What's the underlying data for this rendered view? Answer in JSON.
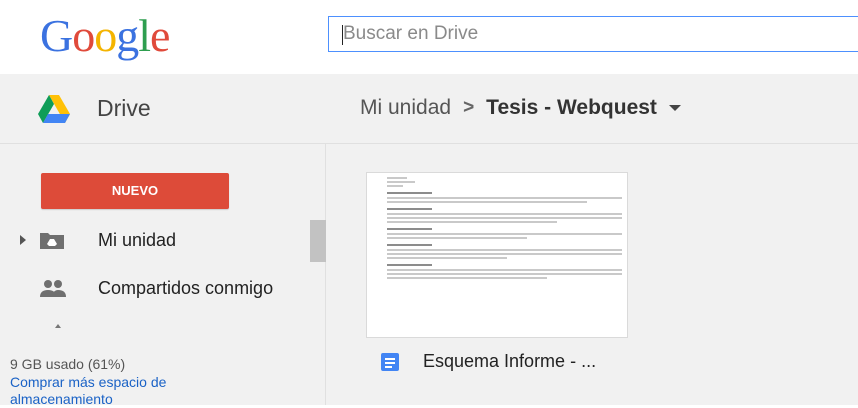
{
  "header": {
    "logo_letters": [
      "G",
      "o",
      "o",
      "g",
      "l",
      "e"
    ],
    "logo_colors": [
      "#3b72e0",
      "#e04a3b",
      "#f4b400",
      "#3b72e0",
      "#2e9e4f",
      "#e04a3b"
    ],
    "search_placeholder": "Buscar en Drive"
  },
  "appbar": {
    "app_name": "Drive",
    "breadcrumb_root": "Mi unidad",
    "breadcrumb_separator": ">",
    "breadcrumb_current": "Tesis - Webquest"
  },
  "sidebar": {
    "new_button": "NUEVO",
    "items": [
      {
        "label": "Mi unidad",
        "icon": "my-drive-icon"
      },
      {
        "label": "Compartidos conmigo",
        "icon": "shared-people-icon"
      }
    ],
    "storage_used": "9 GB usado (61%)",
    "buy_storage": "Comprar más espacio de almacenamiento"
  },
  "files": [
    {
      "name": "Esquema Informe - ...",
      "icon": "google-docs-icon"
    }
  ],
  "colors": {
    "accent_red": "#dd4b39",
    "link_blue": "#1a62c6",
    "doc_blue": "#4285f4"
  }
}
